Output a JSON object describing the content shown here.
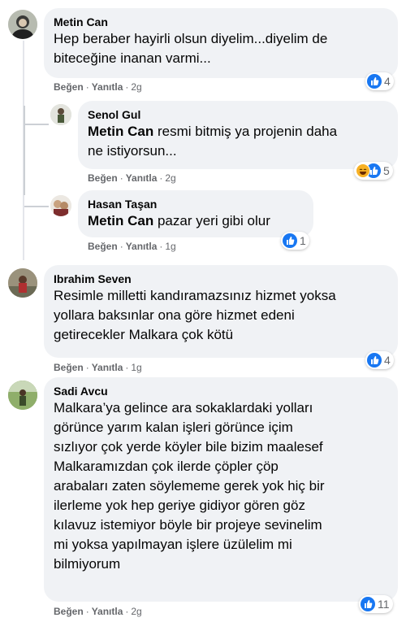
{
  "comments": [
    {
      "author": "Metin Can",
      "lines": [
        "Hep beraber hayirli olsun diyelim...diyelim de",
        "biteceğine inanan varmi..."
      ],
      "like": "Beğen",
      "reply": "Yanıtla",
      "time": "2g",
      "reaction_count": "4",
      "replies": [
        {
          "author": "Senol Gul",
          "mention": "Metin Can",
          "line1_rest": " resmi bitmiş ya projenin daha",
          "line2": "ne istiyorsun...",
          "like": "Beğen",
          "reply": "Yanıtla",
          "time": "2g",
          "reaction_count": "5"
        },
        {
          "author": "Hasan Taşan",
          "mention": "Metin Can",
          "line1_rest": " pazar yeri gibi olur",
          "like": "Beğen",
          "reply": "Yanıtla",
          "time": "1g",
          "reaction_count": "1"
        }
      ]
    },
    {
      "author": "Ibrahim Seven",
      "lines": [
        "Resimle milletti kandıramazsınız hizmet yoksa",
        "yollara baksınlar ona göre hizmet edeni",
        "getirecekler Malkara çok kötü"
      ],
      "like": "Beğen",
      "reply": "Yanıtla",
      "time": "1g",
      "reaction_count": "4"
    },
    {
      "author": "Sadi Avcu",
      "lines": [
        "Malkara’ya gelince ara sokaklardaki yolları",
        "görünce yarım kalan işleri görünce içim",
        "sızlıyor çok yerde köyler bile bizim maalesef",
        "Malkaramızdan çok ilerde çöpler çöp",
        "arabaları zaten söylememe gerek yok hiç bir",
        "ilerleme yok hep geriye gidiyor gören göz",
        "kılavuz istemiyor böyle bir projeye sevinelim",
        "mi yoksa yapılmayan işlere üzülelim mi",
        "bilmiyorum"
      ],
      "like": "Beğen",
      "reply": "Yanıtla",
      "time": "2g",
      "reaction_count": "11"
    }
  ],
  "separator": "·",
  "colors": {
    "bubble": "#f0f2f5",
    "like_blue": "#1877f2",
    "meta_gray": "#65676b",
    "haha_yellow": "#f7b125"
  }
}
